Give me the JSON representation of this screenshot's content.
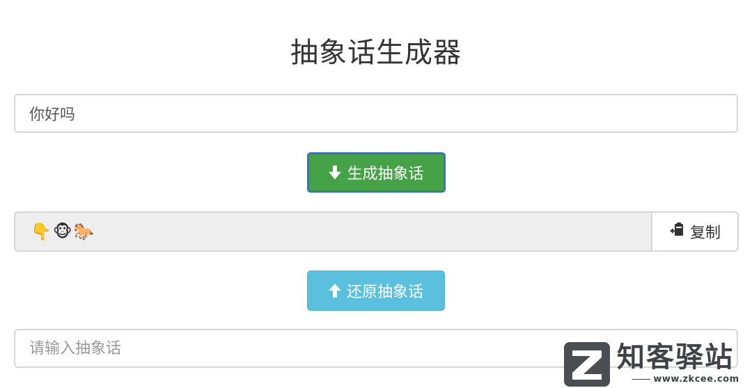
{
  "title": "抽象话生成器",
  "source_input": {
    "value": "你好吗",
    "placeholder": ""
  },
  "generate_button": {
    "label": "生成抽象话",
    "icon": "arrow-down-icon",
    "color": "#45a247"
  },
  "output": {
    "value": "👇🐵🐎",
    "copy_label": "复制",
    "copy_icon": "clipboard-icon"
  },
  "restore_button": {
    "label": "还原抽象话",
    "icon": "arrow-up-icon",
    "color": "#5bc0de"
  },
  "decode_input": {
    "value": "",
    "placeholder": "请输入抽象话"
  },
  "watermark": {
    "name": "知客驿站",
    "url": "www.zkcee.com"
  }
}
